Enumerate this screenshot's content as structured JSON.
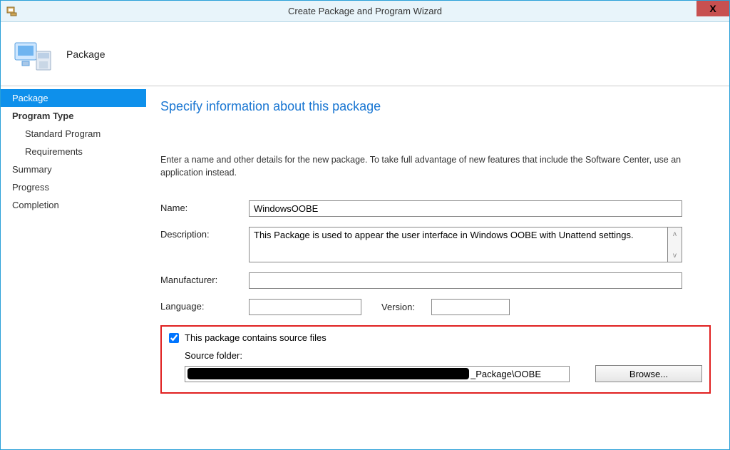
{
  "titlebar": {
    "title": "Create Package and Program Wizard",
    "close": "X"
  },
  "banner": {
    "title": "Package"
  },
  "sidebar": {
    "items": [
      {
        "label": "Package"
      },
      {
        "label": "Program Type"
      },
      {
        "label": "Standard Program"
      },
      {
        "label": "Requirements"
      },
      {
        "label": "Summary"
      },
      {
        "label": "Progress"
      },
      {
        "label": "Completion"
      }
    ]
  },
  "main": {
    "heading": "Specify information about this package",
    "description": "Enter a name and other details for the new package. To take full advantage of new features that include the Software Center, use an application instead.",
    "labels": {
      "name": "Name:",
      "description": "Description:",
      "manufacturer": "Manufacturer:",
      "language": "Language:",
      "version": "Version:",
      "sourceCheckbox": "This package contains source files",
      "sourceFolder": "Source folder:",
      "browse": "Browse..."
    },
    "values": {
      "name": "WindowsOOBE",
      "description": "This Package is used to appear the user interface in Windows OOBE with Unattend settings.",
      "manufacturer": "",
      "language": "",
      "version": "",
      "sourceFolderSuffix": "_Package\\OOBE"
    }
  }
}
